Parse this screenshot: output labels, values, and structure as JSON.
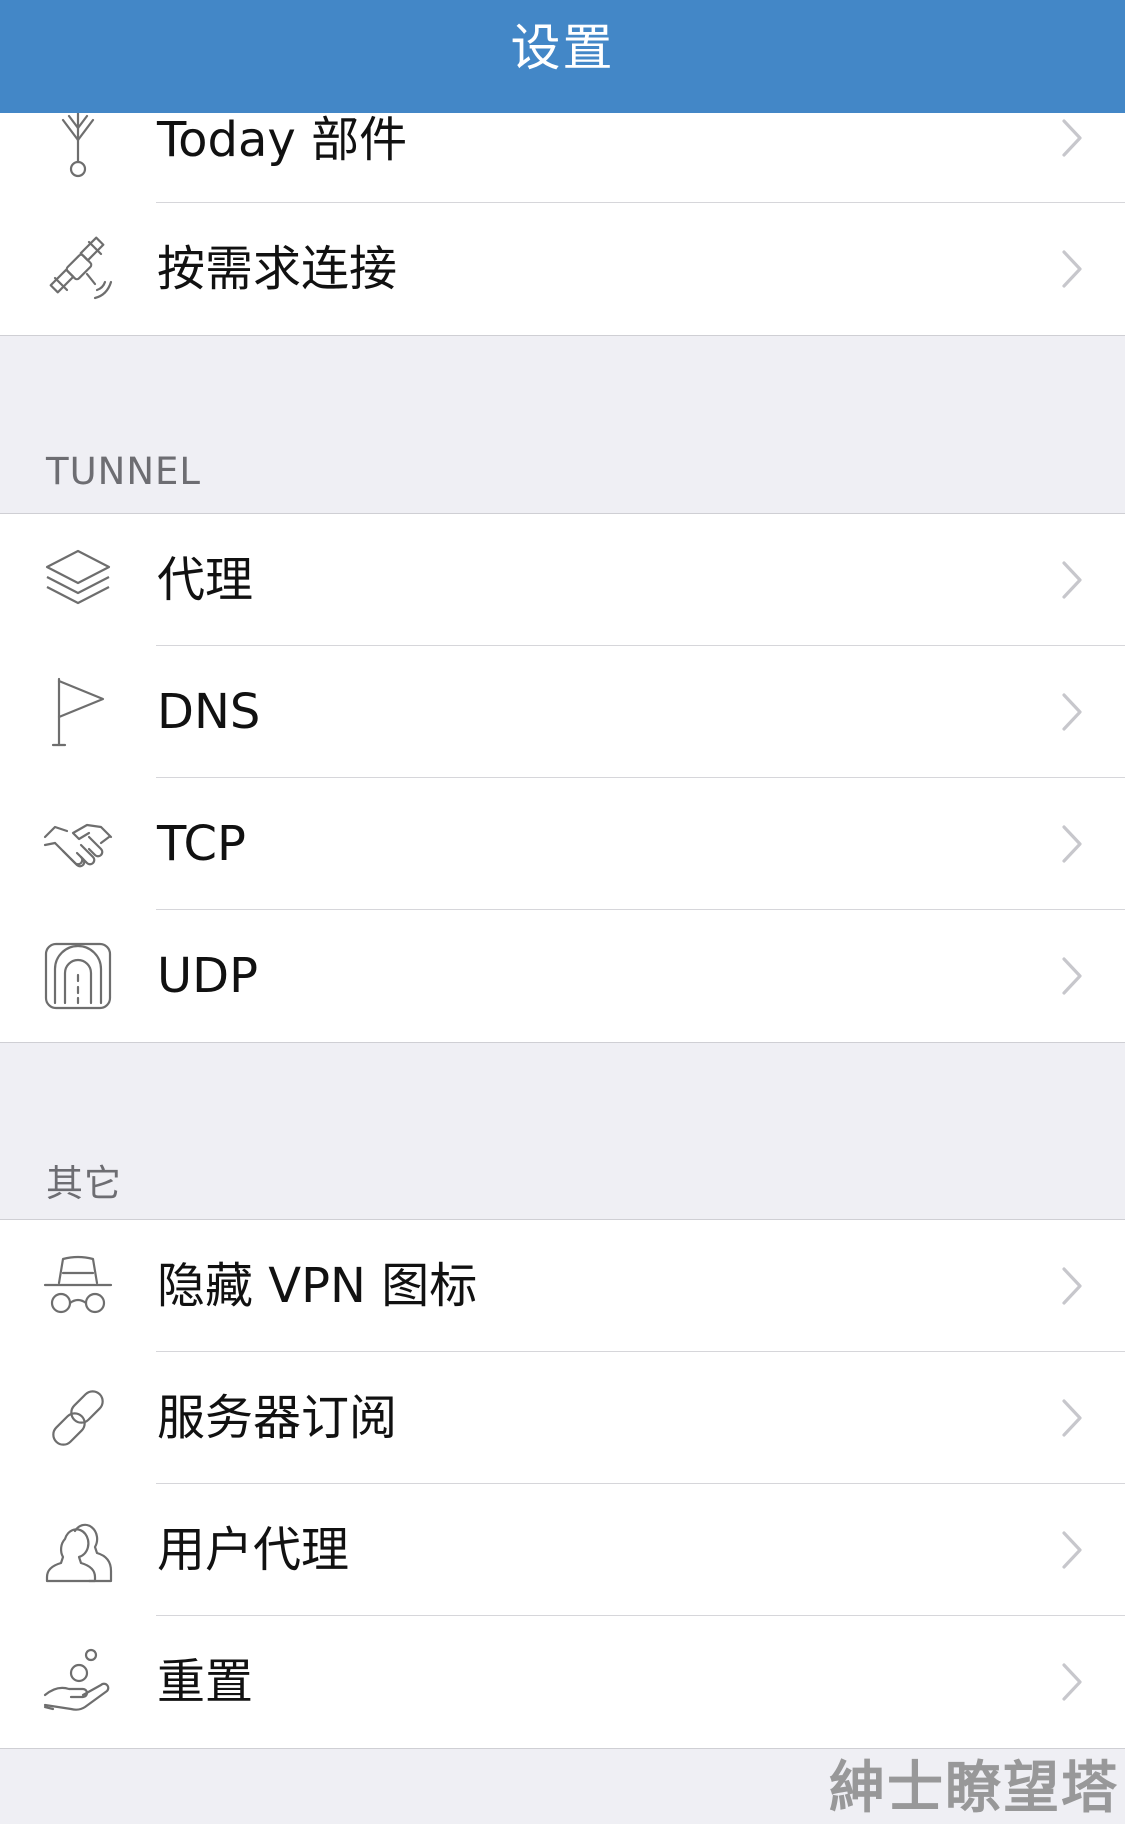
{
  "navbar": {
    "title": "设置"
  },
  "group_general": {
    "items": [
      {
        "label": "Today 部件",
        "icon": "antenna-icon"
      },
      {
        "label": "按需求连接",
        "icon": "satellite-icon"
      }
    ]
  },
  "section_tunnel": {
    "header": "TUNNEL",
    "items": [
      {
        "label": "代理",
        "icon": "layers-icon"
      },
      {
        "label": "DNS",
        "icon": "flag-icon"
      },
      {
        "label": "TCP",
        "icon": "handshake-icon"
      },
      {
        "label": "UDP",
        "icon": "tunnel-icon"
      }
    ]
  },
  "section_other": {
    "header": "其它",
    "items": [
      {
        "label": "隐藏 VPN 图标",
        "icon": "incognito-icon"
      },
      {
        "label": "服务器订阅",
        "icon": "link-icon"
      },
      {
        "label": "用户代理",
        "icon": "users-icon"
      },
      {
        "label": "重置",
        "icon": "hand-reset-icon"
      }
    ]
  },
  "watermark": "紳士瞭望塔",
  "colors": {
    "navbar": "#4387c7",
    "background": "#efeff4",
    "chevron": "#c7c7cc",
    "icon": "#6e6e6e"
  }
}
